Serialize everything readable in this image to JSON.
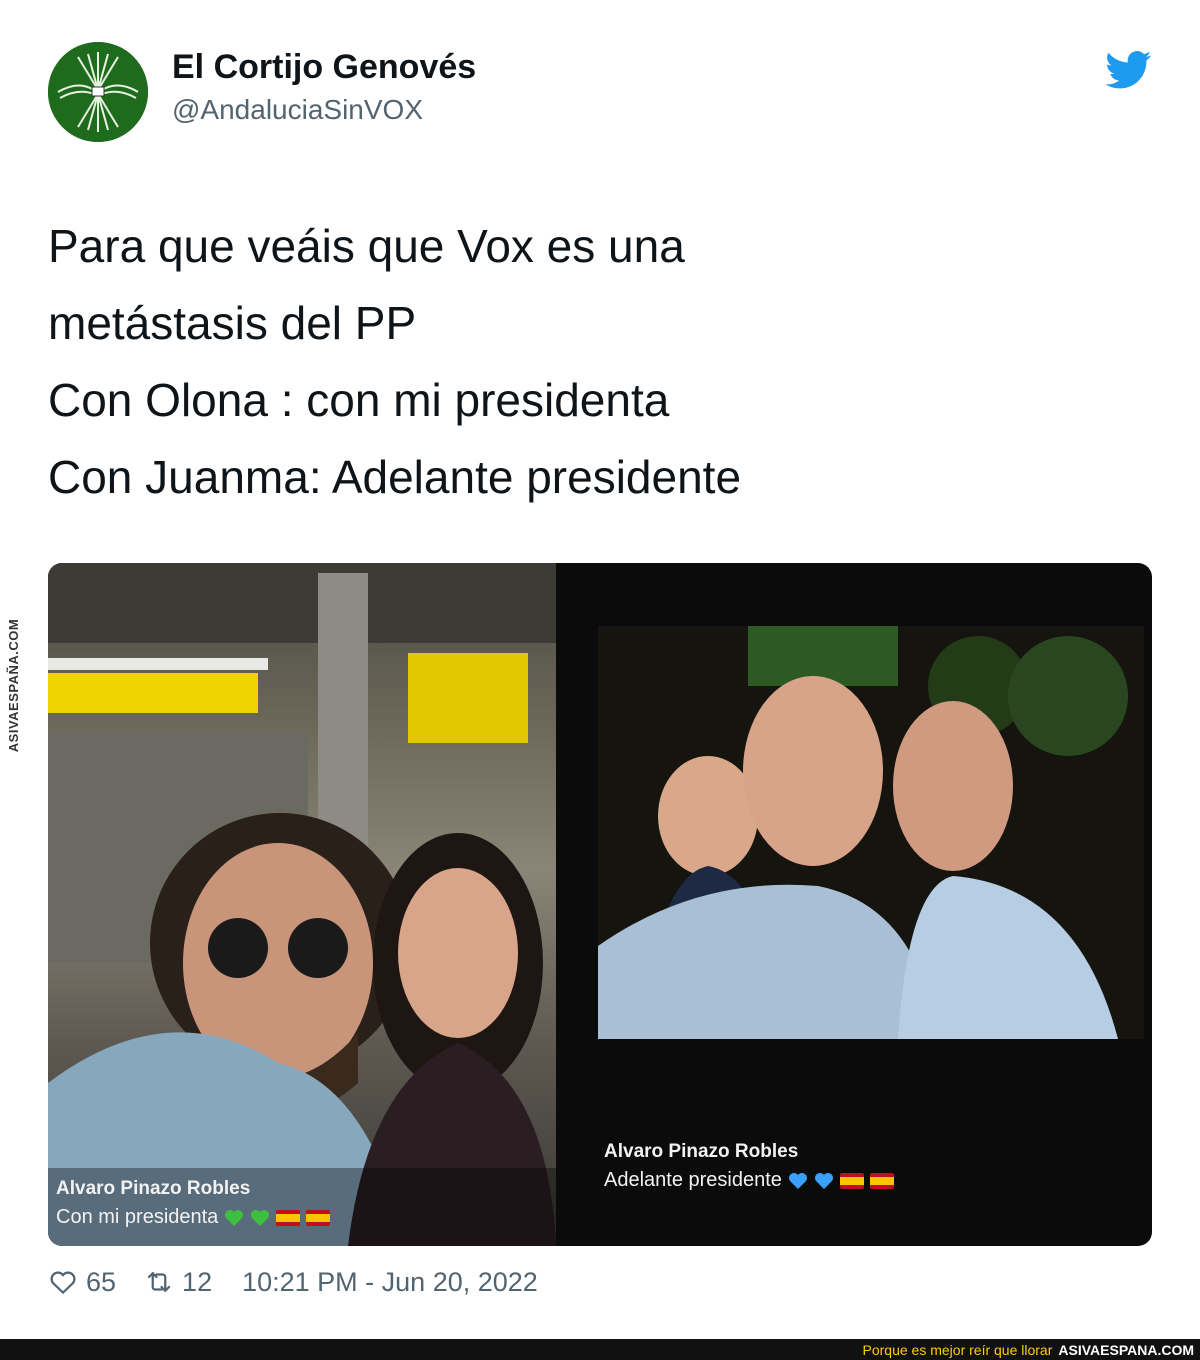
{
  "watermark": {
    "side_text": "ASIVAESPAÑA.COM"
  },
  "tweet": {
    "author_name": "El Cortijo Genovés",
    "author_handle": "@AndaluciaSinVOX",
    "text_lines": [
      "Para que veáis que Vox es una",
      "metástasis del PP",
      "Con Olona : con mi presidenta",
      "Con Juanma: Adelante presidente"
    ],
    "media": {
      "left_caption": {
        "name": "Alvaro Pinazo Robles",
        "text": "Con mi presidenta",
        "heart_color": "#3fbf3f"
      },
      "right_caption": {
        "name": "Alvaro Pinazo Robles",
        "text": "Adelante presidente",
        "heart_color": "#3aa0ff"
      }
    },
    "likes": "65",
    "retweets": "12",
    "timestamp": "10:21 PM - Jun 20, 2022"
  },
  "colors": {
    "twitter_blue": "#1d9bf0",
    "avatar_green": "#1f6b1d",
    "footer_grey": "#536471"
  },
  "bottom_bar": {
    "tagline": "Porque es mejor reír que llorar",
    "brand": "ASIVAESPANA.COM"
  }
}
